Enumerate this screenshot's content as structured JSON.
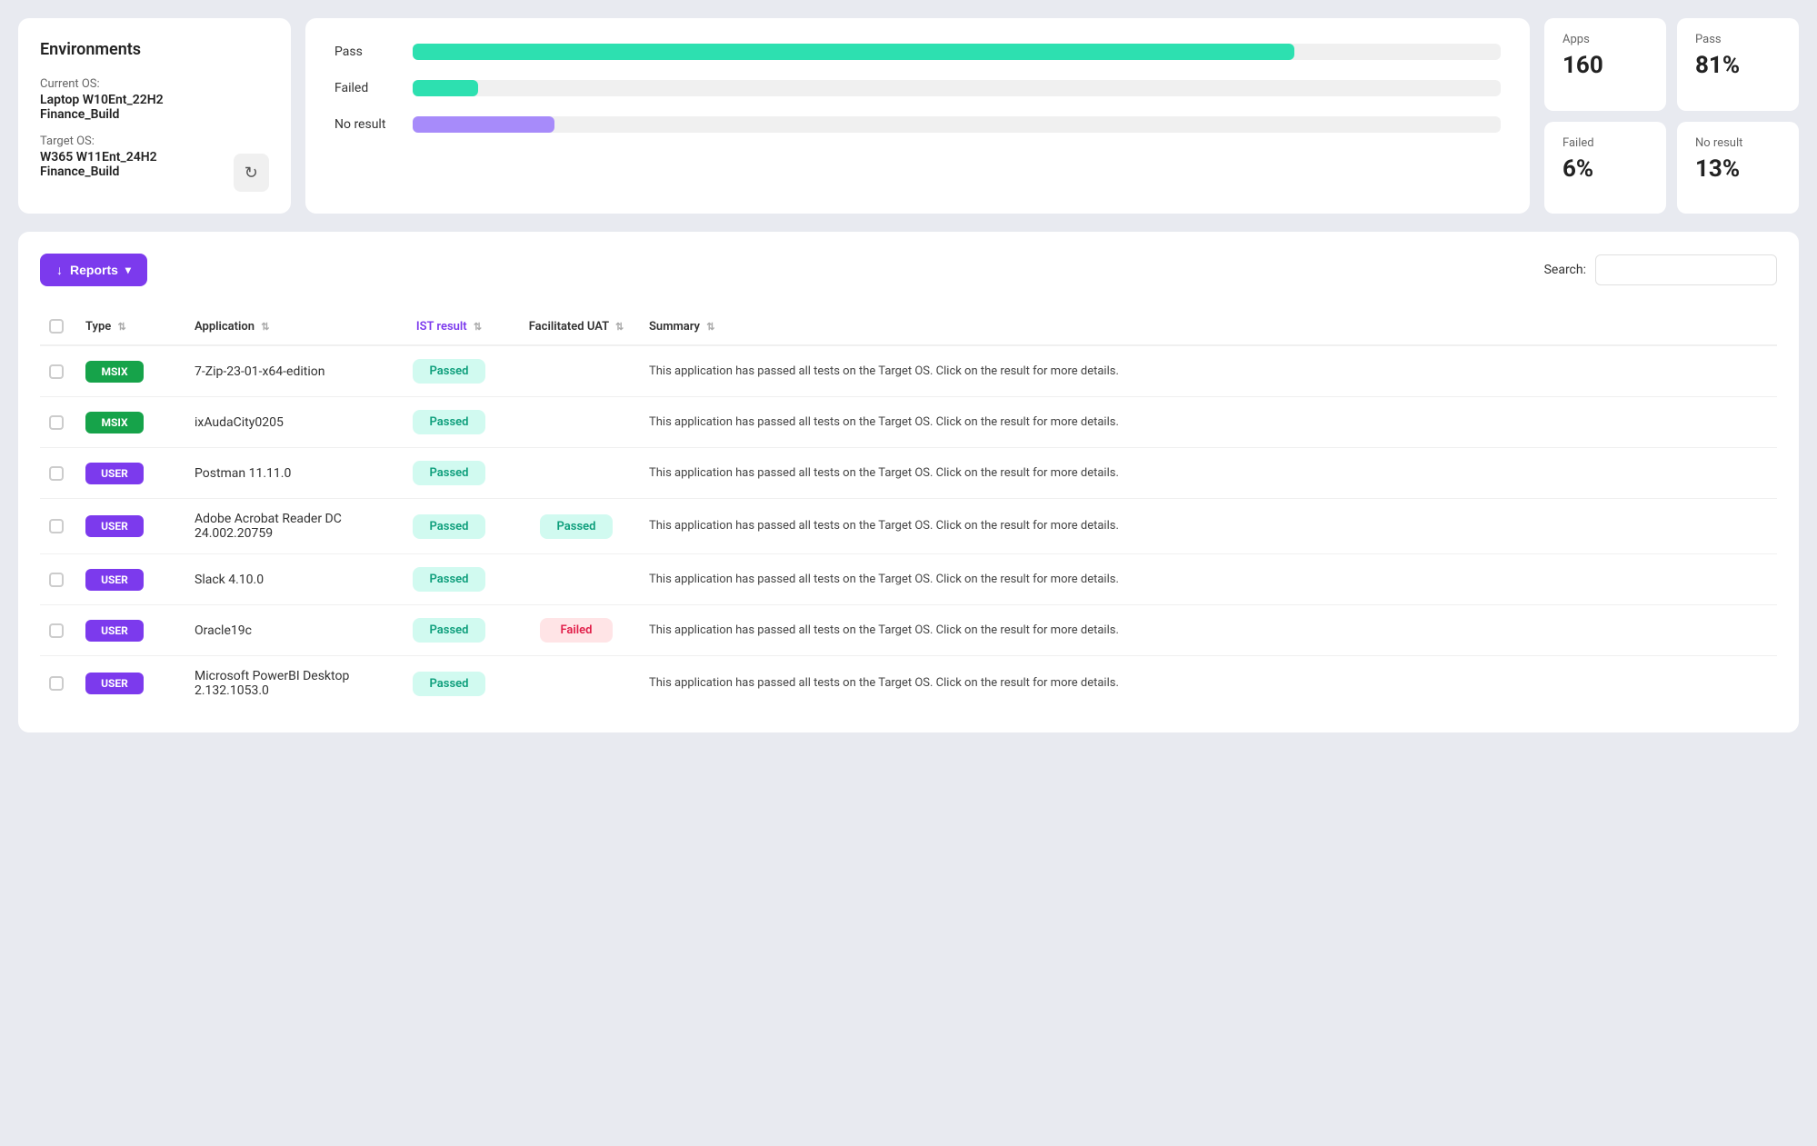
{
  "environments": {
    "title": "Environments",
    "current_os_label": "Current OS:",
    "current_os_value": "Laptop W10Ent_22H2 Finance_Build",
    "target_os_label": "Target OS:",
    "target_os_value": "W365 W11Ent_24H2 Finance_Build"
  },
  "chart": {
    "rows": [
      {
        "label": "Pass",
        "color_class": "bar-pass"
      },
      {
        "label": "Failed",
        "color_class": "bar-fail"
      },
      {
        "label": "No result",
        "color_class": "bar-noresult"
      }
    ]
  },
  "stats": {
    "apps_label": "Apps",
    "apps_value": "160",
    "pass_label": "Pass",
    "pass_value": "81%",
    "failed_label": "Failed",
    "failed_value": "6%",
    "noresult_label": "No result",
    "noresult_value": "13%"
  },
  "toolbar": {
    "reports_label": "Reports",
    "search_label": "Search:",
    "search_placeholder": ""
  },
  "table": {
    "columns": [
      {
        "key": "type",
        "label": "Type"
      },
      {
        "key": "application",
        "label": "Application"
      },
      {
        "key": "ist_result",
        "label": "IST result",
        "highlight": true
      },
      {
        "key": "facilitated_uat",
        "label": "Facilitated UAT"
      },
      {
        "key": "summary",
        "label": "Summary"
      }
    ],
    "rows": [
      {
        "type": "MSIX",
        "type_class": "badge-msix",
        "application": "7-Zip-23-01-x64-edition",
        "ist_result": "Passed",
        "facilitated_uat": "",
        "summary": "This application has passed all tests on the Target OS. Click on the result for more details."
      },
      {
        "type": "MSIX",
        "type_class": "badge-msix",
        "application": "ixAudaCity0205",
        "ist_result": "Passed",
        "facilitated_uat": "",
        "summary": "This application has passed all tests on the Target OS. Click on the result for more details."
      },
      {
        "type": "USER",
        "type_class": "badge-user",
        "application": "Postman 11.11.0",
        "ist_result": "Passed",
        "facilitated_uat": "",
        "summary": "This application has passed all tests on the Target OS. Click on the result for more details."
      },
      {
        "type": "USER",
        "type_class": "badge-user",
        "application": "Adobe Acrobat Reader DC 24.002.20759",
        "ist_result": "Passed",
        "facilitated_uat": "Passed",
        "facilitated_uat_class": "badge-passed",
        "summary": "This application has passed all tests on the Target OS. Click on the result for more details."
      },
      {
        "type": "USER",
        "type_class": "badge-user",
        "application": "Slack 4.10.0",
        "ist_result": "Passed",
        "facilitated_uat": "",
        "summary": "This application has passed all tests on the Target OS. Click on the result for more details."
      },
      {
        "type": "USER",
        "type_class": "badge-user",
        "application": "Oracle19c",
        "ist_result": "Passed",
        "facilitated_uat": "Failed",
        "facilitated_uat_class": "badge-failed",
        "summary": "This application has passed all tests on the Target OS. Click on the result for more details."
      },
      {
        "type": "USER",
        "type_class": "badge-user",
        "application": "Microsoft PowerBI Desktop 2.132.1053.0",
        "ist_result": "Passed",
        "facilitated_uat": "",
        "summary": "This application has passed all tests on the Target OS. Click on the result for more details."
      }
    ]
  }
}
